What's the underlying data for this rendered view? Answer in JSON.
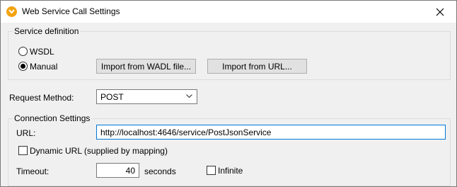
{
  "window": {
    "title": "Web Service Call Settings"
  },
  "service_definition": {
    "legend": "Service definition",
    "wsdl_label": "WSDL",
    "manual_label": "Manual",
    "selected": "Manual",
    "import_wadl_button": "Import from WADL file...",
    "import_url_button": "Import from URL..."
  },
  "request_method": {
    "label": "Request Method:",
    "value": "POST"
  },
  "connection_settings": {
    "legend": "Connection Settings",
    "url_label": "URL:",
    "url_value": "http://localhost:4646/service/PostJsonService",
    "dynamic_url_label": "Dynamic URL (supplied by mapping)",
    "dynamic_url_checked": false,
    "timeout_label": "Timeout:",
    "timeout_value": "40",
    "timeout_unit": "seconds",
    "infinite_label": "Infinite",
    "infinite_checked": false
  },
  "colors": {
    "app_icon": "#f2a30f",
    "focus_border": "#0078d7"
  }
}
